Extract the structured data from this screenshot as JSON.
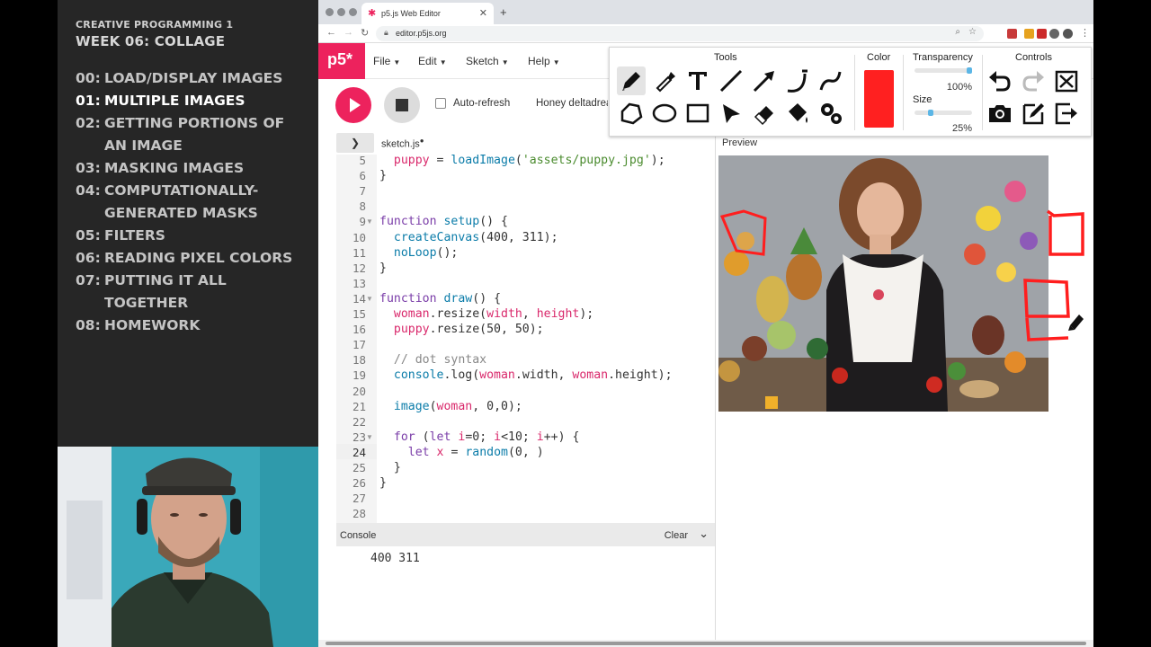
{
  "course": {
    "title": "CREATIVE PROGRAMMING 1",
    "week": "WEEK 06: COLLAGE",
    "lessons": [
      {
        "num": "00:",
        "text": "LOAD/DISPLAY IMAGES"
      },
      {
        "num": "01:",
        "text": "MULTIPLE IMAGES"
      },
      {
        "num": "02:",
        "text": "GETTING PORTIONS OF AN IMAGE"
      },
      {
        "num": "03:",
        "text": "MASKING IMAGES"
      },
      {
        "num": "04:",
        "text": "COMPUTATIONALLY-GENERATED MASKS"
      },
      {
        "num": "05:",
        "text": "FILTERS"
      },
      {
        "num": "06:",
        "text": "READING PIXEL COLORS"
      },
      {
        "num": "07:",
        "text": "PUTTING IT ALL TOGETHER"
      },
      {
        "num": "08:",
        "text": "HOMEWORK"
      }
    ]
  },
  "browser": {
    "tab_title": "p5.js Web Editor",
    "url": "editor.p5js.org"
  },
  "editor": {
    "logo": "p5*",
    "menus": [
      "File",
      "Edit",
      "Sketch",
      "Help"
    ],
    "auto_refresh": "Auto-refresh",
    "project_name": "Honey deltadrea",
    "file_name": "sketch.js",
    "preview_label": "Preview",
    "console_label": "Console",
    "console_clear": "Clear",
    "console_output": "400 311",
    "current_line": "24",
    "line_numbers": [
      "5",
      "6",
      "7",
      "8",
      "9",
      "10",
      "11",
      "12",
      "13",
      "14",
      "15",
      "16",
      "17",
      "18",
      "19",
      "20",
      "21",
      "22",
      "23",
      "24",
      "25",
      "26",
      "27",
      "28"
    ]
  },
  "tools_panel": {
    "tools_label": "Tools",
    "color_label": "Color",
    "transparency_label": "Transparency",
    "transparency_value": "100%",
    "size_label": "Size",
    "size_value": "25%",
    "controls_label": "Controls",
    "selected_color": "#ff2020",
    "transparency_fraction": 1.0,
    "size_fraction": 0.25
  },
  "colors": {
    "p5_pink": "#ed225d",
    "sidebar_bg": "#262626"
  }
}
